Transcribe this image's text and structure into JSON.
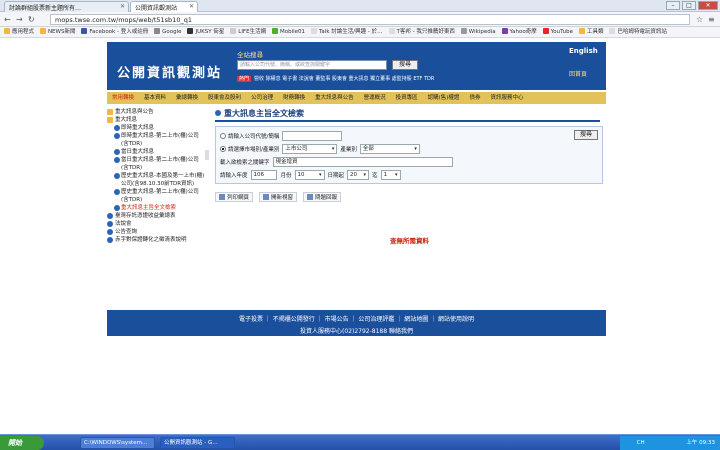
{
  "browser": {
    "tabs": [
      {
        "label": "討論群組股票新主題所有…",
        "active": false
      },
      {
        "label": "公開資訊觀測站",
        "active": true
      }
    ],
    "url": "mops.twse.com.tw/mops/web/t51sb10_q1",
    "bookmarks": [
      "應用程式",
      "NEWS新聞",
      "Facebook - 登入或註冊",
      "Google",
      "JUKSY 街星",
      "LIFE生活網",
      "Mobile01",
      "Talk 討論生活/興趣 - 於…",
      "T客邦 - 我只推薦好東西",
      "Wikipedia",
      "Yahoo奇摩",
      "YouTube",
      "工具類",
      "巴哈姆特電玩資訊站"
    ]
  },
  "header": {
    "logo": "公開資訊觀測站",
    "search_label": "全站搜尋",
    "search_placeholder": "請輸入公司代號、簡稱、或欲查詢關鍵字",
    "search_button": "搜尋",
    "hot_label": "熱門",
    "hot_links": "營收 除權息 電子書 法說會 董監事 股東會 重大訊息 獨立董事 處監持股 ETF TDR",
    "english": "English",
    "back_home": "回首頁"
  },
  "menu": [
    "常用轉換",
    "基本資料",
    "彙總轉換",
    "股東會及股利",
    "公司治理",
    "財務轉換",
    "重大訊息與公告",
    "營運概況",
    "投資專區",
    "認購(售)權證",
    "債券",
    "資訊服務中心"
  ],
  "sidebar": [
    {
      "label": "重大訊息與公告",
      "level": 0,
      "folder": true
    },
    {
      "label": "重大訊息",
      "level": 0,
      "folder": true
    },
    {
      "label": "即時重大訊息",
      "level": 1
    },
    {
      "label": "即時重大訊息-第二上市(櫃)公司(含TDR)",
      "level": 1
    },
    {
      "label": "當日重大訊息",
      "level": 1
    },
    {
      "label": "當日重大訊息-第二上市(櫃)公司(含TDR)",
      "level": 1
    },
    {
      "label": "歷史重大訊息-本國及第一上市(櫃)公司(含98.10.30前TDR資訊)",
      "level": 1
    },
    {
      "label": "歷史重大訊息-第二上市(櫃)公司(含TDR)",
      "level": 1
    },
    {
      "label": "重大訊息主旨全文檢索",
      "level": 1,
      "active": true
    },
    {
      "label": "臺灣存託憑證收益彙總表",
      "level": 0
    },
    {
      "label": "法說會",
      "level": 0
    },
    {
      "label": "公告查詢",
      "level": 0
    },
    {
      "label": "赤字對保證轉化之徵清表說明",
      "level": 0
    }
  ],
  "content": {
    "title": "重大訊息主旨全文檢索",
    "company_label": "請輸入公司代號/簡稱",
    "company_value": "",
    "market_label": "請選擇市場別/產業別",
    "market_value": "上市公司",
    "industry_label": "產業別",
    "industry_value": "全部",
    "keyword_label": "載入欲檢索之關鍵字",
    "keyword_value": "現金增資",
    "year_label": "請輸入年度",
    "year_value": "106",
    "month_label": "月份",
    "month_value": "10",
    "day_label": "日期起",
    "day_value": "20",
    "to_label": "迄",
    "to_value": "1",
    "query_button": "搜尋",
    "tools": [
      "列印網頁",
      "開新視窗",
      "問題回報"
    ],
    "no_result": "查無所需資料"
  },
  "footer": {
    "links": "電子投票 ｜ 不揭櫃公開發行 ｜ 市場公告 ｜ 公司治理評鑑 ｜ 網站地圖 ｜ 網站使用說明",
    "contact": "投資人服務中心(02)2792-8188 聯絡我們"
  },
  "taskbar": {
    "start": "開始",
    "items": [
      "C:\\WINDOWS\\system…",
      "公開資訊觀測站 - G…"
    ],
    "lang": "CH",
    "time": "上午 09:33"
  }
}
